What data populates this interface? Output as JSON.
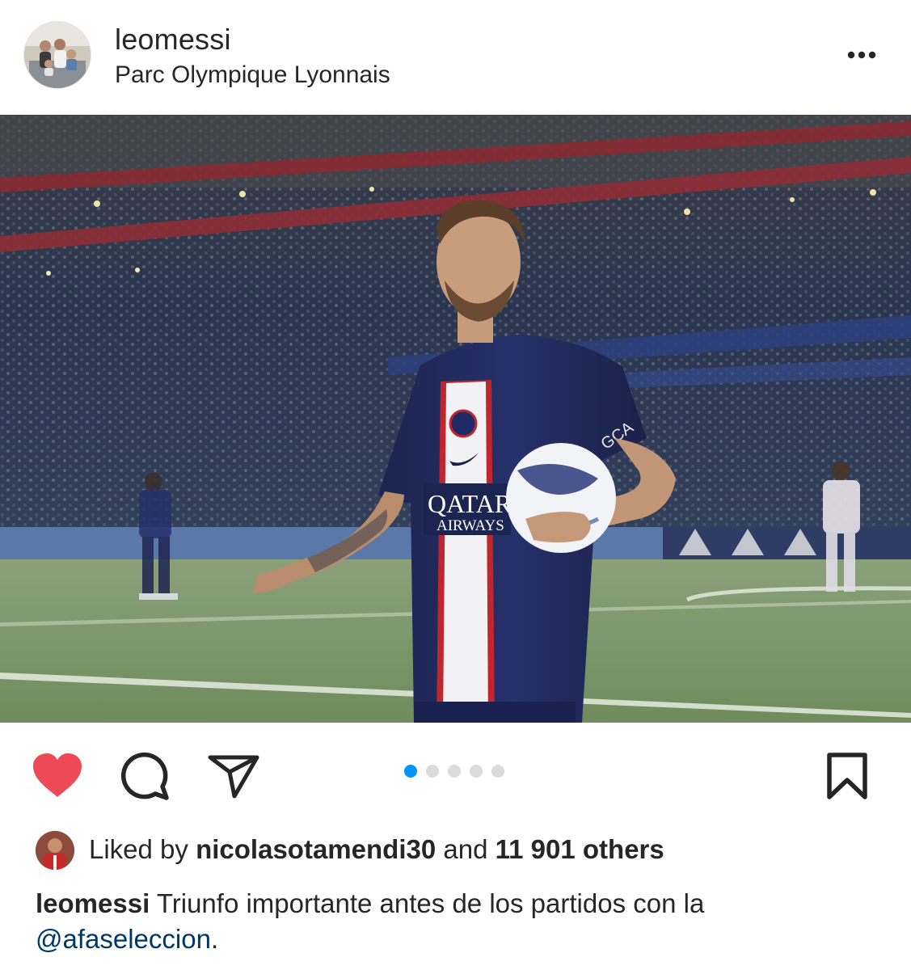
{
  "header": {
    "username": "leomessi",
    "location": "Parc Olympique Lyonnais",
    "more_icon": "more-horizontal-icon"
  },
  "photo": {
    "jersey_sponsor_line1": "QATAR",
    "jersey_sponsor_line2": "AIRWAYS",
    "sleeve_text": "GCA"
  },
  "actions": {
    "like_icon": "heart-filled-icon",
    "comment_icon": "comment-icon",
    "share_icon": "send-icon",
    "save_icon": "bookmark-icon",
    "liked": true,
    "carousel": {
      "count": 5,
      "active_index": 0
    }
  },
  "likes": {
    "prefix": "Liked by",
    "liker": "nicolasotamendi30",
    "connector": "and",
    "others": "11 901 others"
  },
  "caption": {
    "username": "leomessi",
    "text": " Triunfo importante antes de los partidos con la",
    "mention": "@afaseleccion",
    "suffix": "."
  },
  "colors": {
    "like_red": "#ed4956",
    "carousel_active": "#0095f6",
    "carousel_inactive": "#dbdbdb",
    "mention_blue": "#00376b",
    "text": "#262626"
  }
}
